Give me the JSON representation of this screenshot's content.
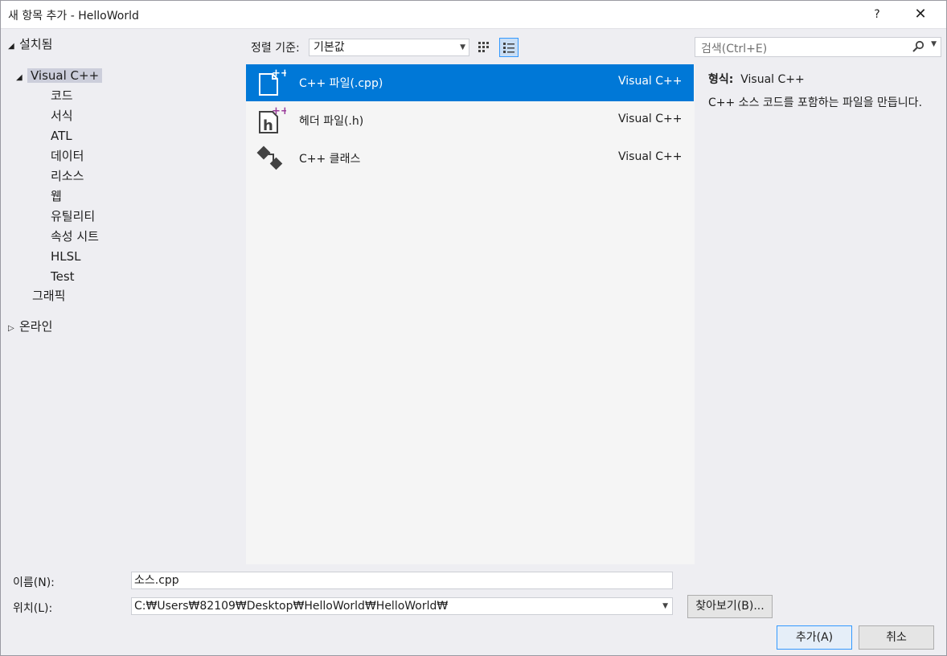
{
  "window": {
    "title": "새 항목 추가 - HelloWorld",
    "help": "?",
    "close": "✕"
  },
  "tree": {
    "installed": "설치됨",
    "visual_cpp": "Visual C++",
    "children": [
      "코드",
      "서식",
      "ATL",
      "데이터",
      "리소스",
      "웹",
      "유틸리티",
      "속성 시트",
      "HLSL",
      "Test"
    ],
    "graphics": "그래픽",
    "online": "온라인"
  },
  "toolbar": {
    "sort_label": "정렬 기준:",
    "sort_value": "기본값"
  },
  "search": {
    "placeholder": "검색(Ctrl+E)"
  },
  "items": [
    {
      "name": "C++ 파일(.cpp)",
      "lang": "Visual C++",
      "icon": "cpp-file-icon",
      "selected": true
    },
    {
      "name": "헤더 파일(.h)",
      "lang": "Visual C++",
      "icon": "header-file-icon",
      "selected": false
    },
    {
      "name": "C++ 클래스",
      "lang": "Visual C++",
      "icon": "cpp-class-icon",
      "selected": false
    }
  ],
  "details": {
    "type_label": "형식:",
    "type_value": "Visual C++",
    "description": "C++ 소스 코드를 포함하는 파일을 만듭니다."
  },
  "bottom": {
    "name_label": "이름(N):",
    "name_value": "소스.cpp",
    "location_label": "위치(L):",
    "location_value": "C:₩Users₩82109₩Desktop₩HelloWorld₩HelloWorld₩",
    "browse_label": "찾아보기(B)...",
    "add_label": "추가(A)",
    "cancel_label": "취소"
  },
  "colors": {
    "selection": "#0078d7",
    "accent_border": "#3399ff",
    "tree_selection": "#cccedb"
  }
}
